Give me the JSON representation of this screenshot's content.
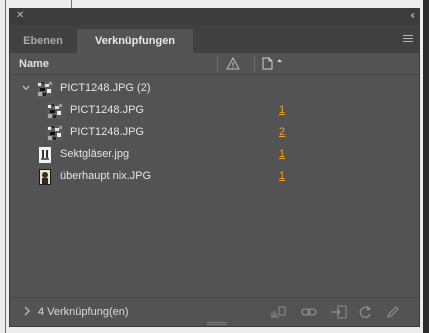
{
  "panel": {
    "tabs": [
      {
        "label": "Ebenen",
        "active": false
      },
      {
        "label": "Verknüpfungen",
        "active": true
      }
    ],
    "columns": {
      "name": "Name"
    }
  },
  "links": [
    {
      "name": "PICT1248.JPG (2)",
      "level": 0,
      "expanded": true,
      "page": "",
      "thumb": "photo"
    },
    {
      "name": "PICT1248.JPG",
      "level": 1,
      "page": "1",
      "thumb": "photo"
    },
    {
      "name": "PICT1248.JPG",
      "level": 1,
      "page": "2",
      "thumb": "photo"
    },
    {
      "name": "Sektgläser.jpg",
      "level": 0,
      "page": "1",
      "thumb": "bottle"
    },
    {
      "name": "überhaupt nix.JPG",
      "level": 0,
      "page": "1",
      "thumb": "portrait"
    }
  ],
  "footer": {
    "count_label": "4 Verknüpfung(en)"
  },
  "colors": {
    "panel": "#535353",
    "accent_link": "#f0a224"
  }
}
